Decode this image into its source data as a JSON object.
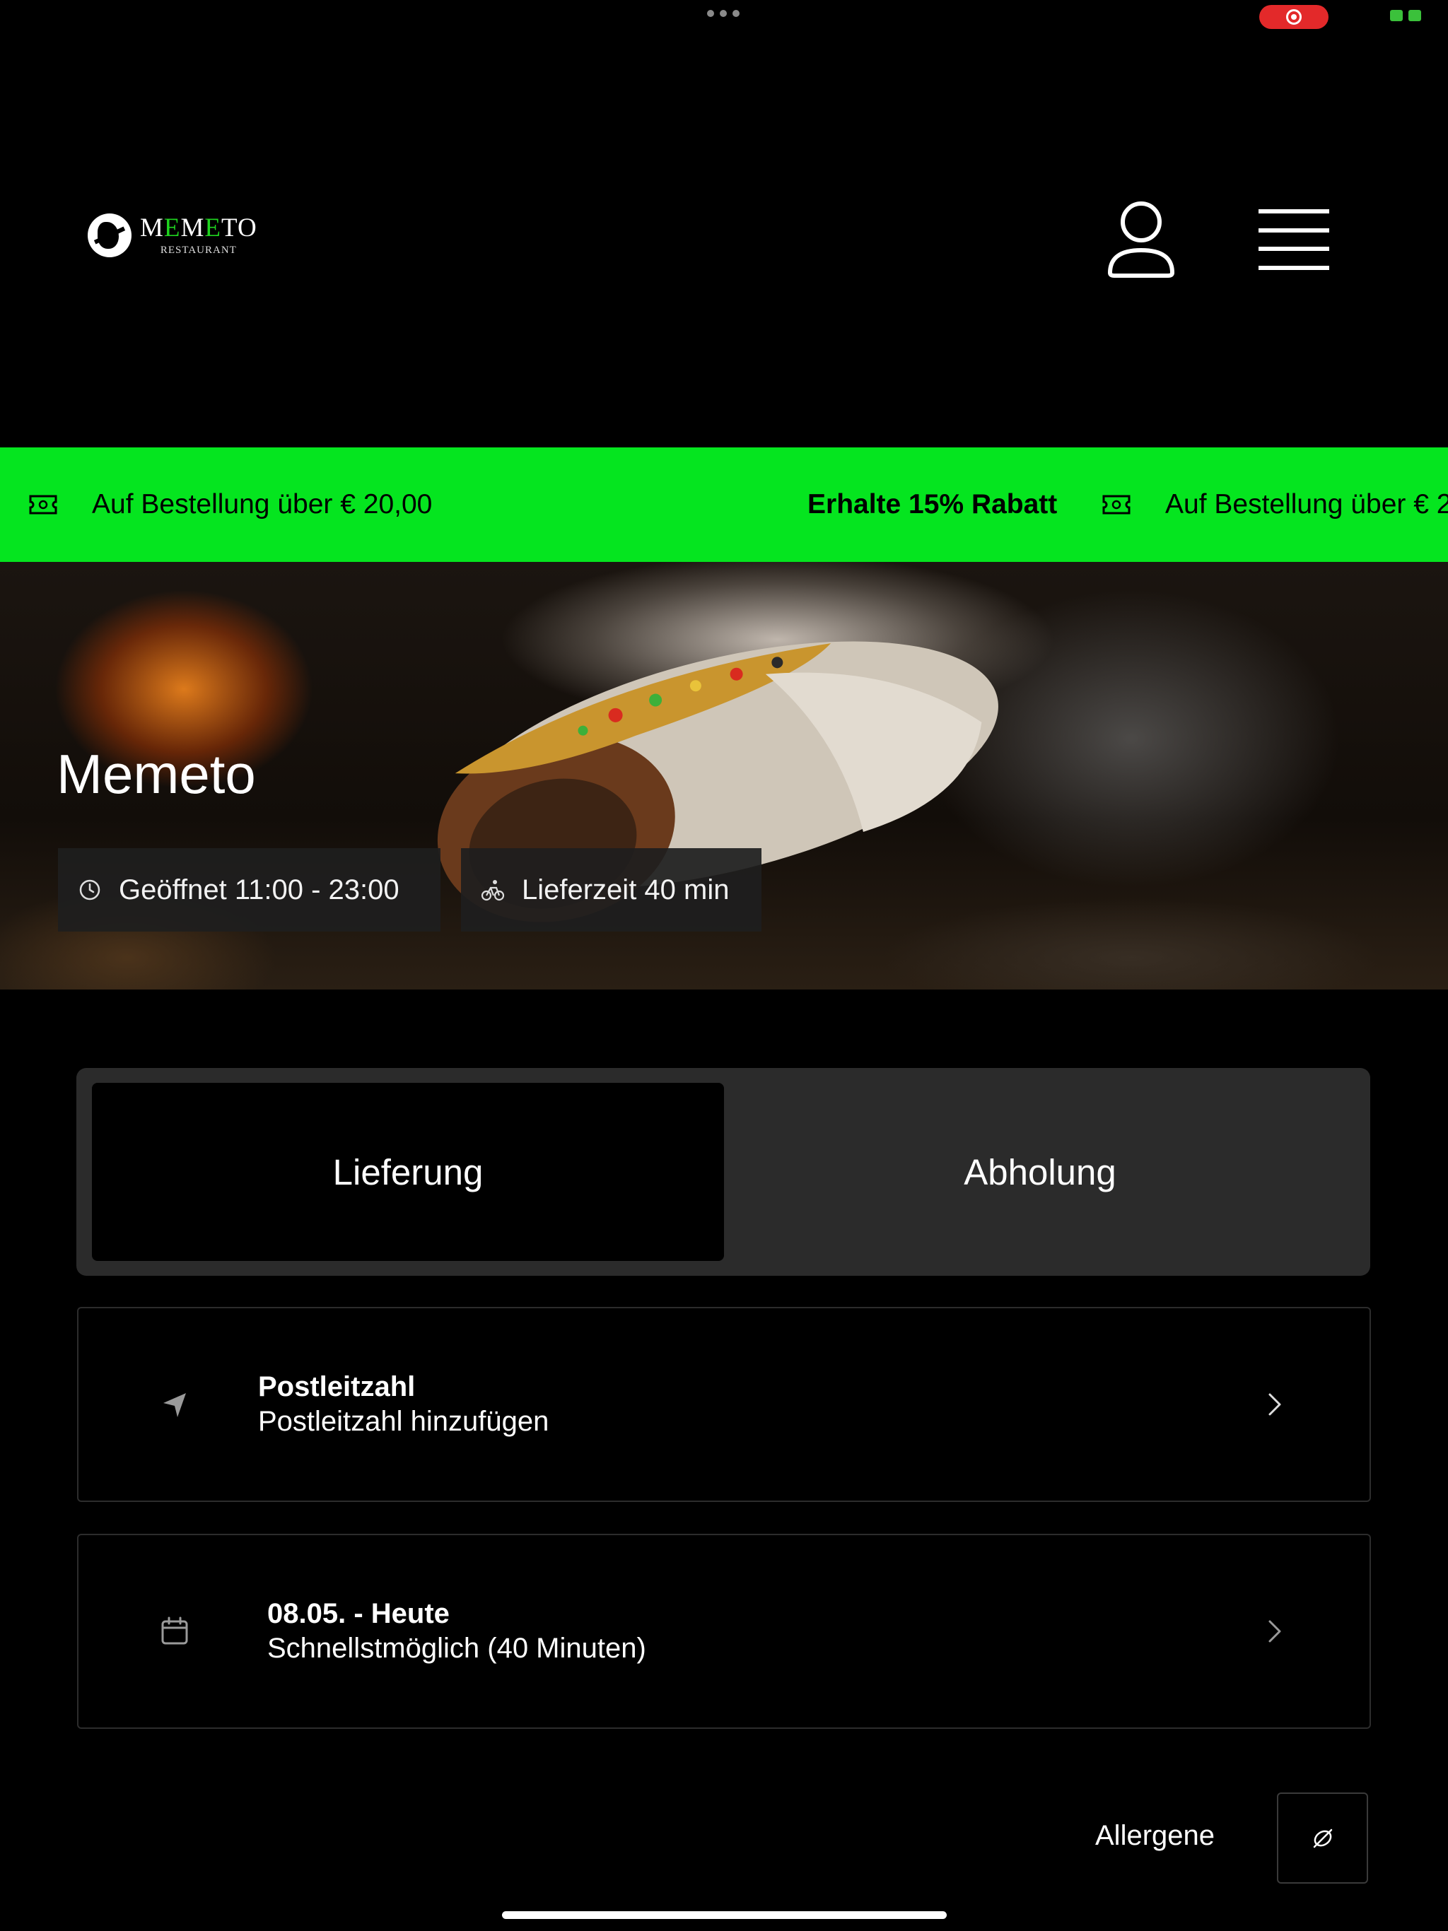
{
  "header": {
    "logo_word_pre": "M",
    "logo_word_g1": "E",
    "logo_word_mid": "M",
    "logo_word_g2": "E",
    "logo_word_post": "TO",
    "logo_sub": "RESTAURANT"
  },
  "promo": {
    "item1_text": "Auf Bestellung über € 20,00",
    "item2_text": "Erhalte 15% Rabatt",
    "item3_text": "Auf Bestellung über € 20,00",
    "color": "#05e51f"
  },
  "hero": {
    "title": "Memeto",
    "open_hours": "Geöffnet 11:00 - 23:00",
    "delivery_time": "Lieferzeit 40 min"
  },
  "order_mode": {
    "tabs": [
      {
        "label": "Lieferung",
        "selected": true
      },
      {
        "label": "Abholung",
        "selected": false
      }
    ]
  },
  "zip_card": {
    "title": "Postleitzahl",
    "subtitle": "Postleitzahl hinzufügen",
    "icon": "location-arrow-icon"
  },
  "date_card": {
    "title": "08.05. - Heute",
    "subtitle": "Schnellstmöglich (40 Minuten)",
    "icon": "calendar-icon"
  },
  "allergens": {
    "label": "Allergene",
    "icon": "allergen-icon"
  }
}
